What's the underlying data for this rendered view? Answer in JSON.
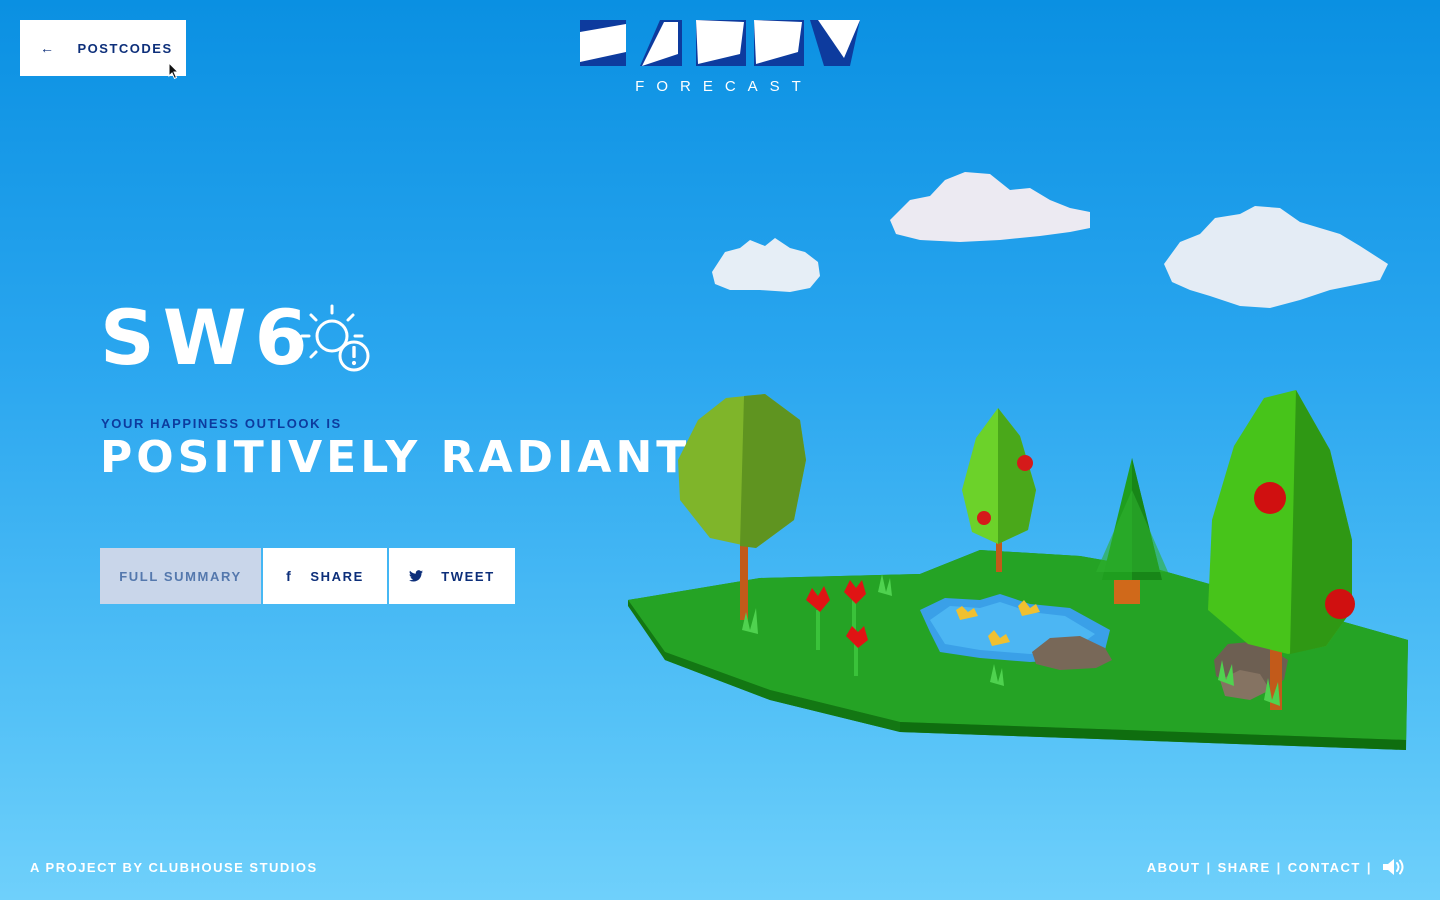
{
  "nav": {
    "back_label": "POSTCODES",
    "back_arrow": "←"
  },
  "logo": {
    "wordmark": "HAPPY",
    "subtitle": "FORECAST"
  },
  "main": {
    "postcode": "SW6",
    "weather_icon": "sun-warning-icon",
    "outlook_label": "YOUR HAPPINESS OUTLOOK IS",
    "outlook_value": "POSITIVELY RADIANT"
  },
  "actions": {
    "summary_label": "FULL SUMMARY",
    "share_label": "SHARE",
    "tweet_label": "TWEET"
  },
  "footer": {
    "credit": "A PROJECT BY CLUBHOUSE STUDIOS",
    "links": [
      "ABOUT",
      "SHARE",
      "CONTACT"
    ],
    "separator": "|",
    "sound_icon": "speaker-icon"
  },
  "colors": {
    "sky_top": "#0a90e2",
    "sky_bottom": "#6fd0fb",
    "navy": "#0d2f7a",
    "accent_blue": "#0d3b9e",
    "summary_bg": "#c9d6ea",
    "grass": "#1e9a1e"
  }
}
